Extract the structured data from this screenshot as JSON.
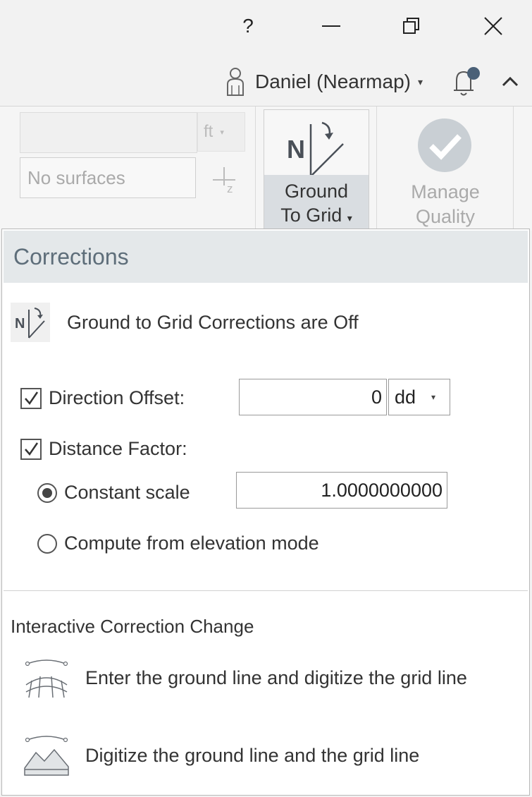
{
  "window": {
    "help_label": "?",
    "minimize_icon": "minimize-icon",
    "restore_icon": "restore-icon",
    "close_icon": "close-icon"
  },
  "user": {
    "name": "Daniel (Nearmap)",
    "caret": "▾",
    "icons": [
      "user-icon",
      "bell-icon",
      "collapse-icon"
    ]
  },
  "ribbon": {
    "unit": "ft",
    "unit_caret": "▾",
    "surfaces_placeholder": "No surfaces",
    "ground_to_grid": {
      "line1": "Ground",
      "line2": "To Grid",
      "caret": "▾"
    },
    "manage_quality": {
      "line1": "Manage",
      "line2": "Quality"
    }
  },
  "panel": {
    "title": "Corrections",
    "status_text": "Ground to Grid Corrections are Off",
    "direction_offset": {
      "label": "Direction Offset:",
      "checked": true,
      "value": "0",
      "unit": "dd",
      "unit_caret": "▾"
    },
    "distance_factor": {
      "label": "Distance Factor:",
      "checked": true
    },
    "constant_scale": {
      "label": "Constant scale",
      "selected": true,
      "value": "1.0000000000"
    },
    "compute_elevation": {
      "label": "Compute from elevation mode",
      "selected": false
    },
    "interactive_title": "Interactive Correction Change",
    "actions": [
      {
        "label": "Enter the ground line and digitize the grid line",
        "icon": "curved-grid-icon"
      },
      {
        "label": "Digitize the ground line and the grid line",
        "icon": "terrain-lines-icon"
      }
    ]
  }
}
